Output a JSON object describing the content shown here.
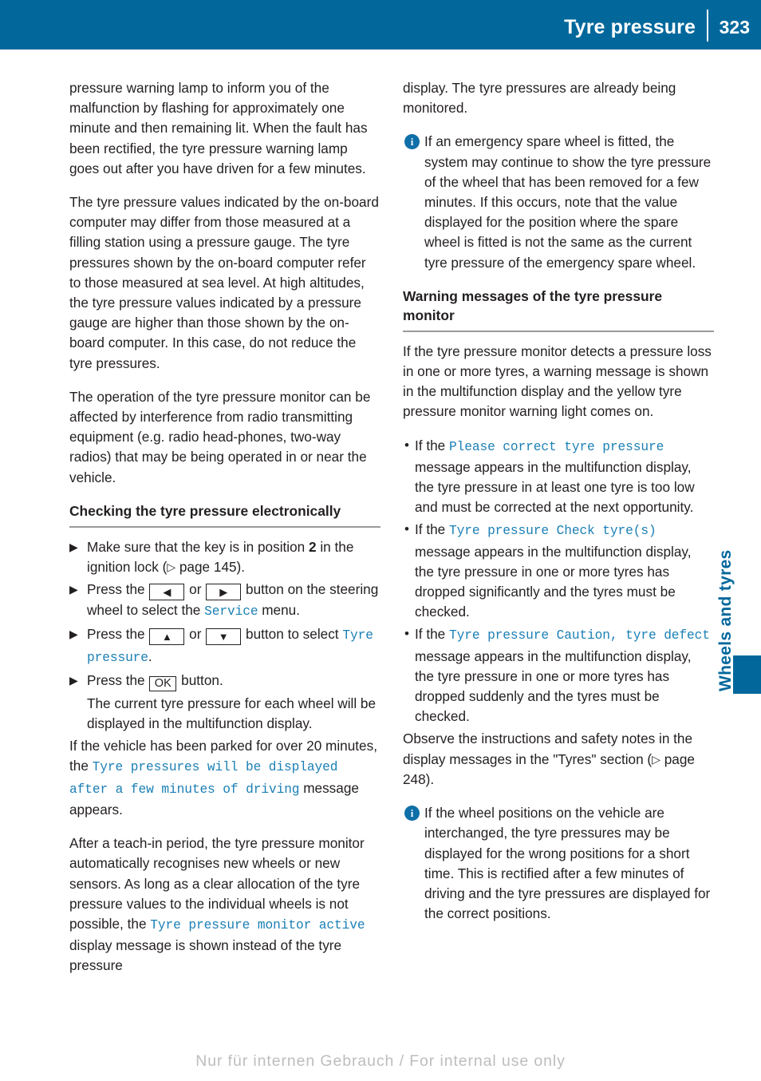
{
  "header": {
    "title": "Tyre pressure",
    "page_number": "323"
  },
  "side_tab": {
    "label": "Wheels and tyres"
  },
  "left_column": {
    "para_1": "pressure warning lamp to inform you of the malfunction by flashing for approximately one minute and then remaining lit. When the fault has been rectified, the tyre pressure warning lamp goes out after you have driven for a few minutes.",
    "para_2": "The tyre pressure values indicated by the on-board computer may differ from those measured at a filling station using a pressure gauge. The tyre pressures shown by the on-board computer refer to those measured at sea level. At high altitudes, the tyre pressure values indicated by a pressure gauge are higher than those shown by the on-board computer. In this case, do not reduce the tyre pressures.",
    "para_3": "The operation of the tyre pressure monitor can be affected by interference from radio transmitting equipment (e.g. radio head-phones, two-way radios) that may be being operated in or near the vehicle.",
    "heading": "Checking the tyre pressure electronically",
    "step_1": {
      "marker": "▶",
      "text_a": "Make sure that the key is in position ",
      "key_position": "2",
      "text_b": " in the ignition lock (",
      "xref_arrow": "▷",
      "xref": " page 145).",
      "text_c": ""
    },
    "step_2": {
      "marker": "▶",
      "text_a": "Press the ",
      "key_left": "◀",
      "text_b": " or ",
      "key_right": "▶",
      "text_c": " button on the steering wheel to select the ",
      "menu": "Service",
      "text_d": " menu."
    },
    "step_3": {
      "marker": "▶",
      "text_a": "Press the ",
      "key_up": "▲",
      "text_b": " or ",
      "key_down": "▼",
      "text_c": " button to select ",
      "menu": "Tyre pressure",
      "text_d": "."
    },
    "step_4": {
      "marker": "▶",
      "text_a": "Press the ",
      "key_ok": "OK",
      "text_b": " button.",
      "result": "The current tyre pressure for each wheel will be displayed in the multifunction display."
    },
    "para_4": {
      "text_a": "If the vehicle has been parked for over 20 minutes, the ",
      "message": "Tyre pressures will be displayed after a few minutes of driving",
      "text_b": " message appears."
    },
    "para_5": {
      "text_a": "After a teach-in period, the tyre pressure monitor automatically recognises new wheels or new sensors. As long as a clear allocation of the tyre pressure values to the individual wheels is not possible, the ",
      "message": "Tyre pressure monitor active",
      "text_b": " display message is shown instead of the tyre pressure"
    }
  },
  "right_column": {
    "para_1": "display. The tyre pressures are already being monitored.",
    "note_1": {
      "icon": "info-icon",
      "text": "If an emergency spare wheel is fitted, the system may continue to show the tyre pressure of the wheel that has been removed for a few minutes. If this occurs, note that the value displayed for the position where the spare wheel is fitted is not the same as the current tyre pressure of the emergency spare wheel."
    },
    "heading": "Warning messages of the tyre pressure monitor",
    "para_2": "If the tyre pressure monitor detects a pressure loss in one or more tyres, a warning message is shown in the multifunction display and the yellow tyre pressure monitor warning light comes on.",
    "bullets": [
      {
        "marker": "•",
        "text_a": "If the ",
        "message": "Please correct tyre pressure",
        "text_b": " message appears in the multifunction display, the tyre pressure in at least one tyre is too low and must be corrected at the next opportunity."
      },
      {
        "marker": "•",
        "text_a": "If the ",
        "message": "Tyre pressure Check tyre(s)",
        "text_b": " message appears in the multifunction display, the tyre pressure in one or more tyres has dropped significantly and the tyres must be checked."
      },
      {
        "marker": "•",
        "text_a": "If the ",
        "message": "Tyre pressure Caution, tyre defect",
        "text_b": " message appears in the multifunction display, the tyre pressure in one or more tyres has dropped suddenly and the tyres must be checked."
      }
    ],
    "para_3": {
      "text_a": "Observe the instructions and safety notes in the display messages in the \"Tyres\" section (",
      "xref_arrow": "▷",
      "text_b": " page 248)."
    },
    "note_2": {
      "icon": "info-icon",
      "text": "If the wheel positions on the vehicle are interchanged, the tyre pressures may be displayed for the wrong positions for a short time. This is rectified after a few minutes of driving and the tyre pressures are displayed for the correct positions."
    }
  },
  "footer": {
    "text": "Nur für internen Gebrauch / For internal use only"
  },
  "colors": {
    "header_blue": "#02689C",
    "accent_blue": "#1A7FB5",
    "icon_blue": "#0F6FA8",
    "rule_gray": "#9A9A9A",
    "text_black": "#231F20",
    "footer_gray": "#BDBDBD"
  }
}
